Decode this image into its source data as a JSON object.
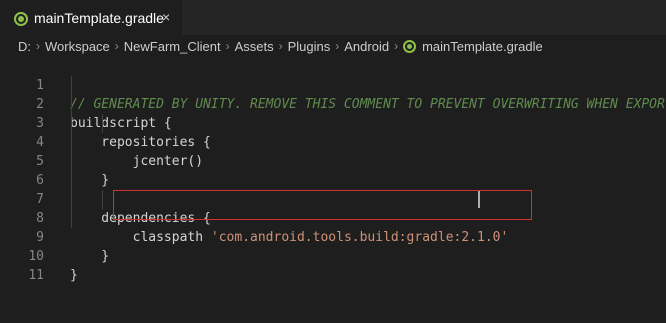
{
  "tab": {
    "icon": "gradle-file-icon",
    "label": "mainTemplate.gradle",
    "close": "×"
  },
  "breadcrumb": {
    "items": [
      "D:",
      "Workspace",
      "NewFarm_Client",
      "Assets",
      "Plugins",
      "Android"
    ],
    "separator": "›",
    "file": "mainTemplate.gradle"
  },
  "editor": {
    "lines": [
      {
        "n": "1",
        "text": "// GENERATED BY UNITY. REMOVE THIS COMMENT TO PREVENT OVERWRITING WHEN EXPORTI",
        "kind": "comment"
      },
      {
        "n": "2",
        "text": "buildscript {",
        "kind": "code"
      },
      {
        "n": "3",
        "text": "    repositories {",
        "kind": "code"
      },
      {
        "n": "4",
        "text": "        jcenter()",
        "kind": "code"
      },
      {
        "n": "5",
        "text": "    }",
        "kind": "code"
      },
      {
        "n": "6",
        "text": "",
        "kind": "code"
      },
      {
        "n": "7",
        "text": "    dependencies {",
        "kind": "code"
      },
      {
        "n": "8",
        "text_prefix": "        classpath ",
        "string": "'com.android.tools.build:gradle:2.1.0'",
        "kind": "mixed"
      },
      {
        "n": "9",
        "text": "    }",
        "kind": "code"
      },
      {
        "n": "10",
        "text": "}",
        "kind": "code"
      },
      {
        "n": "11",
        "text": "",
        "kind": "code"
      }
    ]
  },
  "colors": {
    "background": "#1e1e1e",
    "comment": "#608b4e",
    "string": "#ce9178",
    "highlight": "#d0312d",
    "gradle_icon": "#8dc149"
  }
}
